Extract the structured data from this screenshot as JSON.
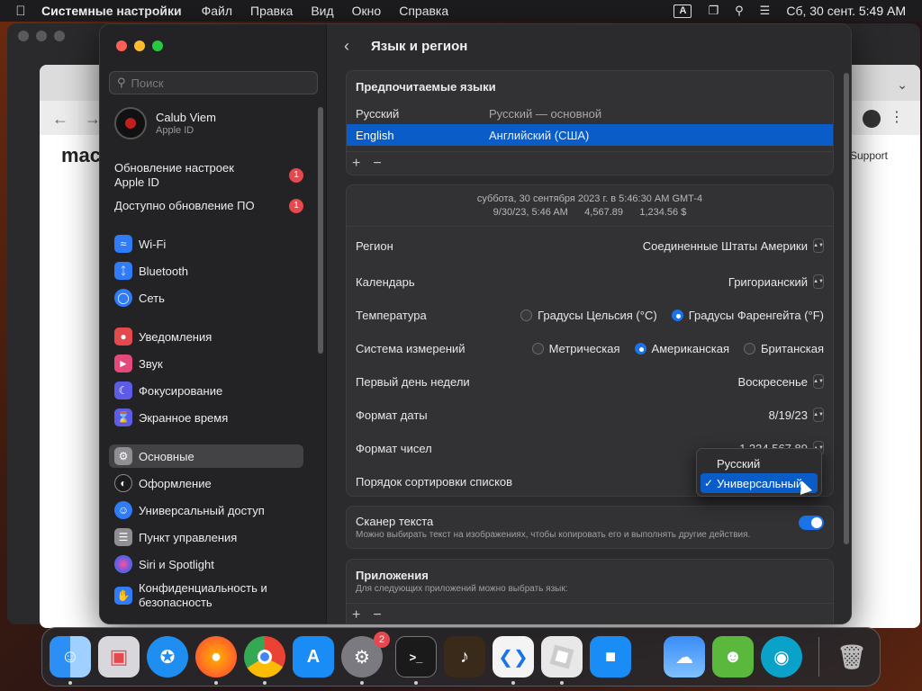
{
  "menubar": {
    "app": "Системные настройки",
    "items": [
      "Файл",
      "Правка",
      "Вид",
      "Окно",
      "Справка"
    ],
    "input_indicator": "A",
    "datetime": "Сб, 30 сент.  5:49 AM"
  },
  "browser": {
    "logo_partial": "mac",
    "support_partial": "Support"
  },
  "sidebar": {
    "search_placeholder": "Поиск",
    "account": {
      "name": "Calub Viem",
      "sub": "Apple ID"
    },
    "notices": [
      {
        "label": "Обновление настроек Apple ID",
        "badge": "1"
      },
      {
        "label": "Доступно обновление ПО",
        "badge": "1"
      }
    ],
    "items": [
      {
        "label": "Wi-Fi",
        "icon": "wifi-icon",
        "color": "#2f7cf6"
      },
      {
        "label": "Bluetooth",
        "icon": "bluetooth-icon",
        "color": "#2f7cf6"
      },
      {
        "label": "Сеть",
        "icon": "globe-icon",
        "color": "#2f7cf6"
      },
      {
        "label": "Уведомления",
        "icon": "bell-icon",
        "color": "#e5484d"
      },
      {
        "label": "Звук",
        "icon": "speaker-icon",
        "color": "#e5487a"
      },
      {
        "label": "Фокусирование",
        "icon": "moon-icon",
        "color": "#5e5ce6"
      },
      {
        "label": "Экранное время",
        "icon": "hourglass-icon",
        "color": "#5e5ce6"
      },
      {
        "label": "Основные",
        "icon": "gear-icon",
        "color": "#8e8e93"
      },
      {
        "label": "Оформление",
        "icon": "appearance-icon",
        "color": "#1c1c1e"
      },
      {
        "label": "Универсальный доступ",
        "icon": "accessibility-icon",
        "color": "#2f7cf6"
      },
      {
        "label": "Пункт управления",
        "icon": "control-center-icon",
        "color": "#8e8e93"
      },
      {
        "label": "Siri и Spotlight",
        "icon": "siri-icon",
        "color": "#af52de"
      },
      {
        "label": "Конфиденциальность и безопасность",
        "icon": "hand-icon",
        "color": "#2f7cf6"
      }
    ]
  },
  "main": {
    "title": "Язык и регион",
    "preferred": {
      "heading": "Предпочитаемые языки",
      "languages": [
        {
          "name": "Русский",
          "desc": "Русский — основной"
        },
        {
          "name": "English",
          "desc": "Английский (США)"
        }
      ],
      "add": "+",
      "remove": "−"
    },
    "preview": {
      "line1": "суббота, 30 сентября 2023 г. в 5:46:30 AM GMT-4",
      "line2": "9/30/23, 5:46 AM      4,567.89      1,234.56 $"
    },
    "rows": {
      "region": {
        "label": "Регион",
        "value": "Соединенные Штаты Америки"
      },
      "calendar": {
        "label": "Календарь",
        "value": "Григорианский"
      },
      "temperature": {
        "label": "Температура",
        "opt1": "Градусы Цельсия (°C)",
        "opt2": "Градусы Фаренгейта (°F)"
      },
      "measure": {
        "label": "Система измерений",
        "opt1": "Метрическая",
        "opt2": "Американская",
        "opt3": "Британская"
      },
      "first_day": {
        "label": "Первый день недели",
        "value": "Воскресенье"
      },
      "date_format": {
        "label": "Формат даты",
        "value": "8/19/23"
      },
      "number_format": {
        "label": "Формат чисел",
        "value": "1,234,567.89"
      },
      "sort_order": {
        "label": "Порядок сортировки списков"
      }
    },
    "scanner": {
      "title": "Сканер текста",
      "desc": "Можно выбирать текст на изображениях, чтобы копировать его и выполнять другие действия."
    },
    "apps": {
      "title": "Приложения",
      "desc": "Для следующих приложений можно выбрать язык:",
      "add": "+",
      "remove": "−"
    }
  },
  "popup": {
    "options": [
      "Русский",
      "Универсальный"
    ],
    "check": "✓"
  },
  "dock": {
    "badge_settings": "2",
    "apps": [
      {
        "name": "finder-icon",
        "color": "#2b8ff5"
      },
      {
        "name": "launchpad-icon",
        "color": "#d8d8dc"
      },
      {
        "name": "safari-icon",
        "color": "#1e8ef0"
      },
      {
        "name": "firefox-icon",
        "color": "#ff7a1a"
      },
      {
        "name": "chrome-icon",
        "color": "#f0f0f0"
      },
      {
        "name": "app-store-icon",
        "color": "#1a8cf5"
      },
      {
        "name": "system-settings-icon",
        "color": "#7a7a80"
      },
      {
        "name": "terminal-icon",
        "color": "#1a1a1a"
      },
      {
        "name": "garageband-icon",
        "color": "#3a2a1a"
      },
      {
        "name": "vscode-icon",
        "color": "#f4f4f4"
      },
      {
        "name": "roblox-icon",
        "color": "#e8e8e8"
      },
      {
        "name": "roblox-studio-icon",
        "color": "#1a8cf5"
      },
      {
        "name": "weather-icon",
        "color": "#2f7cf6"
      },
      {
        "name": "game-icon",
        "color": "#5ab83c"
      },
      {
        "name": "camera-icon",
        "color": "#0aa2c9"
      },
      {
        "name": "trash-icon",
        "color": "#555558"
      }
    ]
  }
}
